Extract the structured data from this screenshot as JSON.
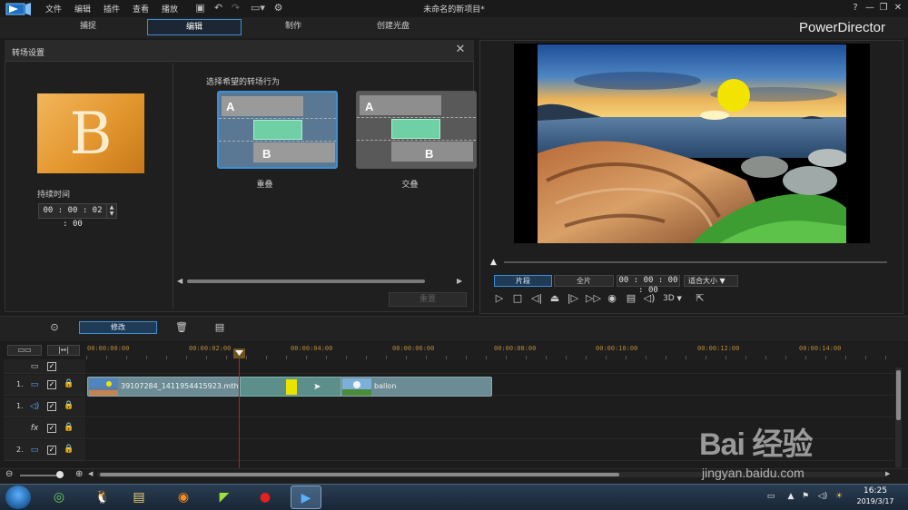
{
  "app": {
    "menu": [
      "文件",
      "编辑",
      "插件",
      "查看",
      "播放"
    ],
    "project_title": "未命名的新项目*",
    "name": "PowerDirector",
    "window_controls": [
      "?",
      "—",
      "❐",
      "✕"
    ]
  },
  "modes": [
    {
      "label": "捕捉",
      "active": false
    },
    {
      "label": "编辑",
      "active": true
    },
    {
      "label": "制作",
      "active": false
    },
    {
      "label": "创建光盘",
      "active": false
    }
  ],
  "transition_panel": {
    "title": "转场设置",
    "thumbnail_letter": "B",
    "duration_label": "持续时间",
    "duration_value": "00 : 00 : 02 : 00",
    "behavior_prompt": "选择希望的转场行为",
    "options": [
      {
        "label": "重叠",
        "letter_a": "A",
        "letter_b": "B",
        "selected": true
      },
      {
        "label": "交叠",
        "letter_a": "A",
        "letter_b": "B",
        "selected": false
      }
    ],
    "apply_label": "重置"
  },
  "preview": {
    "clip_tab": "片段",
    "movie_tab": "全片",
    "timecode": "00 : 00 : 00 : 00",
    "fit_option": "适合大小",
    "three_d": "3D"
  },
  "timeline": {
    "modify_label": "修改",
    "ruler": [
      "00:00:00:00",
      "00:00:02:00",
      "00:00:04:00",
      "00:00:06:00",
      "00:00:08:00",
      "00:00:10:00",
      "00:00:12:00",
      "00:00:14:00"
    ],
    "tracks": [
      {
        "num": "",
        "icon": "▭"
      },
      {
        "num": "1.",
        "icon": "▭"
      },
      {
        "num": "1.",
        "icon": "◁)"
      },
      {
        "num": "",
        "icon": "fx"
      },
      {
        "num": "2.",
        "icon": "▭"
      }
    ],
    "clips": [
      {
        "name": "39107284_1411954415923.mth"
      },
      {
        "name": "ballon"
      }
    ]
  },
  "taskbar": {
    "time": "16:25",
    "date": "2019/3/17"
  },
  "watermark": {
    "brand": "Bai 经验",
    "url": "jingyan.baidu.com"
  },
  "colors": {
    "accent": "#3c8fd6",
    "transition_green": "#6fd0a5",
    "thumb_gold": "#e3962e",
    "playhead_red": "#c01a1a"
  }
}
